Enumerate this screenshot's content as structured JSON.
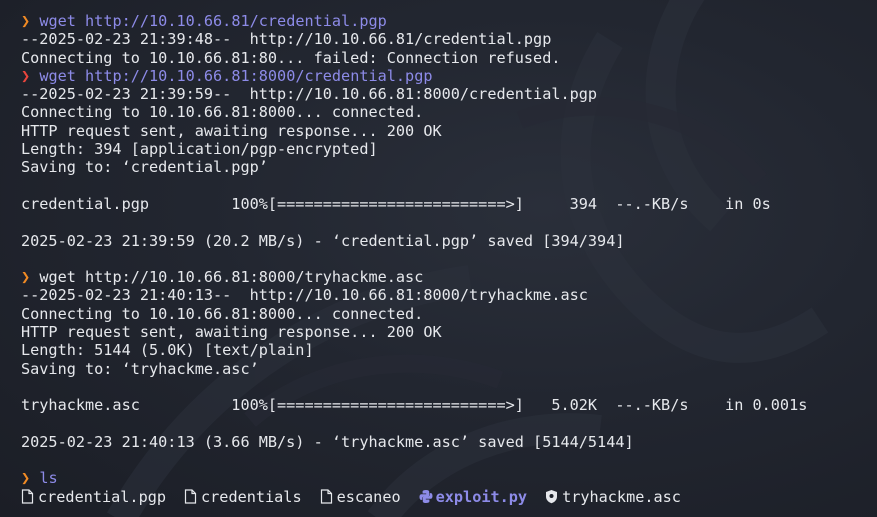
{
  "terminal": {
    "prompt_glyph": "❯",
    "lines": [
      {
        "type": "command",
        "prompt_color": "#f08a24",
        "text": "wget http://10.10.66.81/credential.pgp",
        "cmd_color": "#8d8be8"
      },
      {
        "type": "output",
        "text": "--2025-02-23 21:39:48--  http://10.10.66.81/credential.pgp"
      },
      {
        "type": "output",
        "text": "Connecting to 10.10.66.81:80... failed: Connection refused."
      },
      {
        "type": "command",
        "prompt_color": "#e8453c",
        "text": "wget http://10.10.66.81:8000/credential.pgp",
        "cmd_color": "#8d8be8"
      },
      {
        "type": "output",
        "text": "--2025-02-23 21:39:59--  http://10.10.66.81:8000/credential.pgp"
      },
      {
        "type": "output",
        "text": "Connecting to 10.10.66.81:8000... connected."
      },
      {
        "type": "output",
        "text": "HTTP request sent, awaiting response... 200 OK"
      },
      {
        "type": "output",
        "text": "Length: 394 [application/pgp-encrypted]"
      },
      {
        "type": "output",
        "text": "Saving to: ‘credential.pgp’"
      },
      {
        "type": "blank",
        "text": ""
      },
      {
        "type": "output",
        "text": "credential.pgp         100%[=========================>]     394  --.-KB/s    in 0s"
      },
      {
        "type": "blank",
        "text": ""
      },
      {
        "type": "output",
        "text": "2025-02-23 21:39:59 (20.2 MB/s) - ‘credential.pgp’ saved [394/394]"
      },
      {
        "type": "blank",
        "text": ""
      },
      {
        "type": "command",
        "prompt_color": "#f08a24",
        "text": "wget http://10.10.66.81:8000/tryhackme.asc",
        "cmd_color": "#e6e8ec"
      },
      {
        "type": "output",
        "text": "--2025-02-23 21:40:13--  http://10.10.66.81:8000/tryhackme.asc"
      },
      {
        "type": "output",
        "text": "Connecting to 10.10.66.81:8000... connected."
      },
      {
        "type": "output",
        "text": "HTTP request sent, awaiting response... 200 OK"
      },
      {
        "type": "output",
        "text": "Length: 5144 (5.0K) [text/plain]"
      },
      {
        "type": "output",
        "text": "Saving to: ‘tryhackme.asc’"
      },
      {
        "type": "blank",
        "text": ""
      },
      {
        "type": "output",
        "text": "tryhackme.asc          100%[=========================>]   5.02K  --.-KB/s    in 0.001s"
      },
      {
        "type": "blank",
        "text": ""
      },
      {
        "type": "output",
        "text": "2025-02-23 21:40:13 (3.66 MB/s) - ‘tryhackme.asc’ saved [5144/5144]"
      },
      {
        "type": "blank",
        "text": ""
      },
      {
        "type": "command",
        "prompt_color": "#f08a24",
        "text": "ls",
        "cmd_color": "#8d8be8"
      }
    ],
    "ls_output": [
      {
        "name": "credential.pgp",
        "icon": "file-icon",
        "kind": "file"
      },
      {
        "name": "credentials",
        "icon": "file-icon",
        "kind": "file"
      },
      {
        "name": "escaneo",
        "icon": "file-icon",
        "kind": "file"
      },
      {
        "name": "exploit.py",
        "icon": "python-icon",
        "kind": "exec"
      },
      {
        "name": "tryhackme.asc",
        "icon": "shield-icon",
        "kind": "file"
      }
    ],
    "colors": {
      "background": "#1e222b",
      "text": "#e6e8ec",
      "prompt": "#f08a24",
      "error_prompt": "#e8453c",
      "command": "#8d8be8"
    }
  }
}
